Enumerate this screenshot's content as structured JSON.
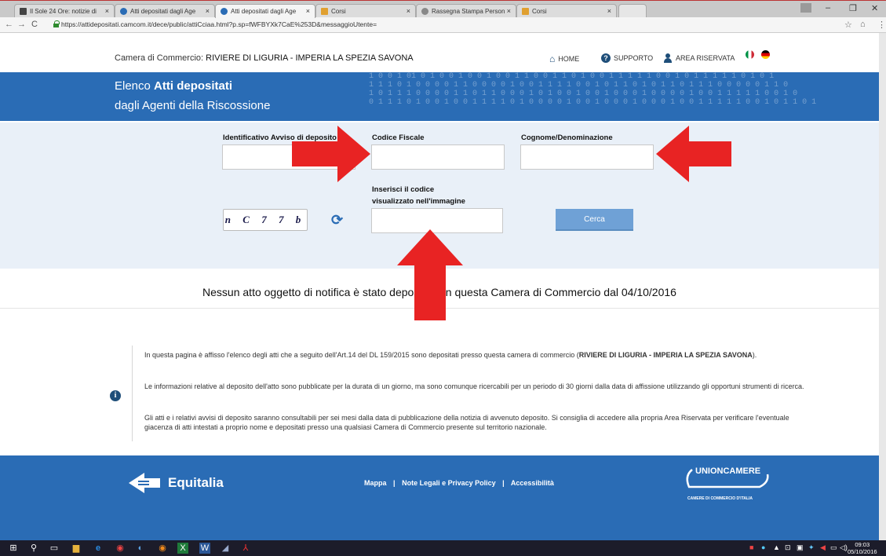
{
  "browser": {
    "tabs": [
      {
        "label": "Il Sole 24 Ore: notizie di"
      },
      {
        "label": "Atti depositati dagli Age"
      },
      {
        "label": "Atti depositati dagli Age"
      },
      {
        "label": "Corsi"
      },
      {
        "label": "Rassegna Stampa Person"
      },
      {
        "label": "Corsi"
      }
    ],
    "url": "https://attidepositati.camcom.it/dece/public/attiCciaa.html?p.sp=fWFBYXk7CaE%253D&messaggioUtente="
  },
  "header": {
    "chamber_prefix": "Camera di Commercio:",
    "chamber_name": "RIVIERE DI LIGURIA - IMPERIA LA SPEZIA SAVONA",
    "home": "HOME",
    "support": "SUPPORTO",
    "reserved": "AREA RISERVATA"
  },
  "banner": {
    "line1_a": "Elenco",
    "line1_b": "Atti depositati",
    "line2": "dagli Agenti della Riscossione",
    "bits": [
      "1 0 0  1 01 0 1 0  0 1 0 0  1 0 0 1 1    0 0 1 1  0 1 0  0 1 1   1 1 1 0 0   1 0 1 1  1 1   1 0 1 0 1",
      "1 1  1 0 1 0 0  0 0 1   1 0 0 0  0 1 0 0   1 1 1 1 0 0 1  0 1  1 0 1 0 1        1 0 1 1 1 0 0 0  0 0 1 1 0",
      "1 0   1 1 1 0 0  0 0 1 1 0   1 1    0 0 0 1 0 1 0   0 1 0 0   1 0 0 0 1 0 0 0 0   1 0 0 1 1 1 1 1 0 0 1 0",
      "0 1 1  1 0 1 0 0 1 0 0  1   1 1   1 0 1 0 0 0 0 1   0 0 1 0 0 0 1 0 0   0 1 0 0  1  1 1 1 1 0 0 1  0 1 1 0 1"
    ]
  },
  "form": {
    "id_label": "Identificativo Avviso di deposito",
    "cf_label": "Codice Fiscale",
    "name_label": "Cognome/Denominazione",
    "captcha_label_1": "Inserisci il codice",
    "captcha_label_2": "visualizzato nell'immagine",
    "captcha_text": "n C 7 7 b",
    "search_button": "Cerca"
  },
  "message": "Nessun atto oggetto di notifica è stato depositato in questa Camera di Commercio dal 04/10/2016",
  "info": {
    "p1_a": "In questa pagina è affisso l'elenco degli atti che a seguito dell'Art.14 del DL 159/2015 sono depositati presso questa camera di commercio (",
    "p1_b": "RIVIERE DI LIGURIA - IMPERIA LA SPEZIA SAVONA",
    "p1_c": ").",
    "p2": "Le informazioni relative al deposito dell'atto sono pubblicate per la durata di un giorno, ma sono comunque ricercabili per un periodo di 30 giorni dalla data di affissione utilizzando gli opportuni strumenti di ricerca.",
    "p3": "Gli atti e i relativi avvisi di deposito saranno consultabili per sei mesi dalla data di pubblicazione della notizia di avvenuto deposito. Si consiglia di accedere alla propria Area Riservata per verificare l'eventuale giacenza di atti intestati a proprio nome e depositati presso una qualsiasi Camera di Commercio presente sul territorio nazionale."
  },
  "footer": {
    "equitalia": "Equitalia",
    "link_map": "Mappa",
    "link_legal": "Note Legali e Privacy Policy",
    "link_access": "Accessibilità",
    "sep": "|",
    "unioncamere": "UNIONCAMERE",
    "unioncamere_sub": "CAMERE DI COMMERCIO D'ITALIA"
  },
  "taskbar": {
    "time": "09:03",
    "date": "05/10/2016"
  },
  "colors": {
    "brand_blue": "#2a6cb5",
    "arrow_red": "#e82323"
  }
}
